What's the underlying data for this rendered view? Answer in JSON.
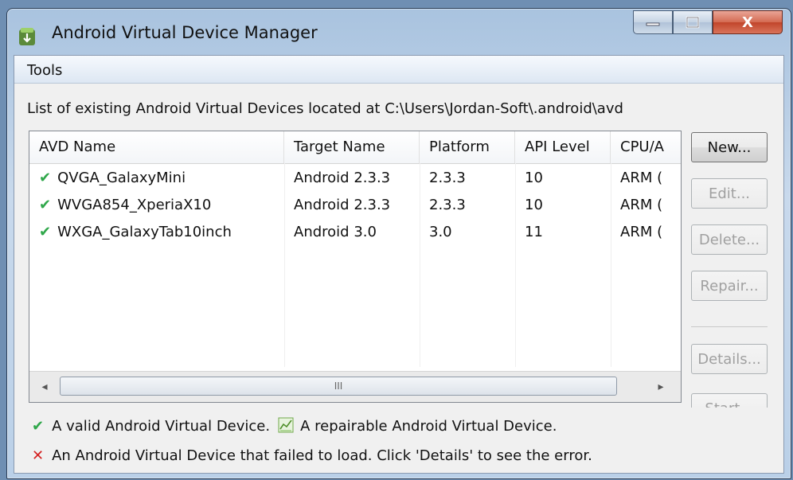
{
  "window": {
    "title": "Android Virtual Device Manager",
    "controls": {
      "minimize": "–",
      "maximize": "□",
      "close": "X"
    }
  },
  "menu": {
    "tools": "Tools"
  },
  "caption": "List of existing Android Virtual Devices located at C:\\Users\\Jordan-Soft\\.android\\avd",
  "table": {
    "columns": [
      "AVD Name",
      "Target Name",
      "Platform",
      "API Level",
      "CPU/A"
    ],
    "rows": [
      {
        "name": "QVGA_GalaxyMini",
        "target": "Android 2.3.3",
        "platform": "2.3.3",
        "api": "10",
        "cpu": "ARM (",
        "status": "valid"
      },
      {
        "name": "WVGA854_XperiaX10",
        "target": "Android 2.3.3",
        "platform": "2.3.3",
        "api": "10",
        "cpu": "ARM (",
        "status": "valid"
      },
      {
        "name": "WXGA_GalaxyTab10inch",
        "target": "Android 3.0",
        "platform": "3.0",
        "api": "11",
        "cpu": "ARM (",
        "status": "valid"
      }
    ],
    "scroll_thumb": "III"
  },
  "buttons": {
    "new": "New...",
    "edit": "Edit...",
    "delete": "Delete...",
    "repair": "Repair...",
    "details": "Details...",
    "start": "Start..."
  },
  "legend": {
    "valid": "A valid Android Virtual Device.",
    "repairable": "A repairable Android Virtual Device.",
    "failed": "An Android Virtual Device that failed to load. Click 'Details' to see the error."
  },
  "icons": {
    "valid": "green-check-icon",
    "repairable": "repair-icon",
    "failed": "red-x-icon"
  },
  "colors": {
    "valid": "#2fa74a",
    "failed": "#d42020"
  }
}
